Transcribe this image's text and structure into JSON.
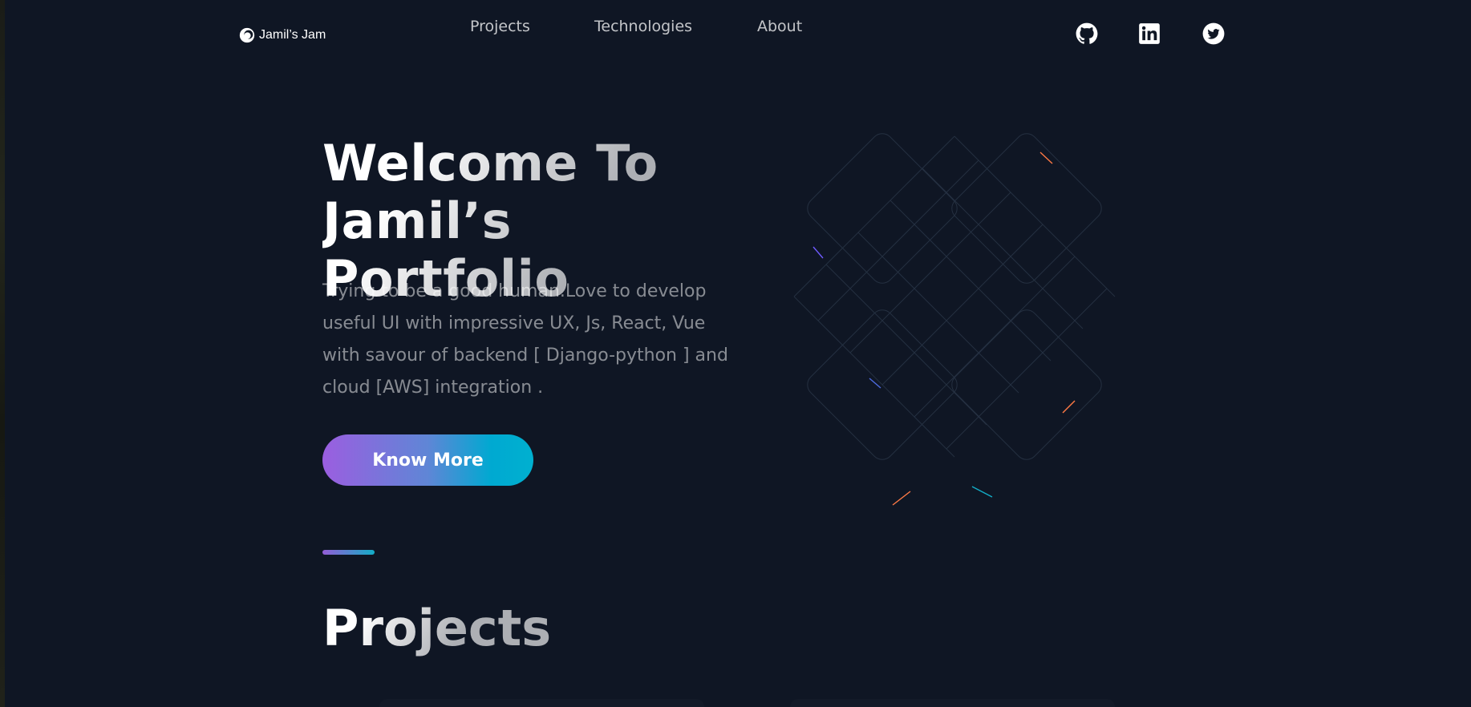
{
  "header": {
    "brand": {
      "name": "Jamil’s Jam",
      "icon": "logo-icon"
    },
    "nav": [
      {
        "label": "Projects"
      },
      {
        "label": "Technologies"
      },
      {
        "label": "About"
      }
    ],
    "socials": [
      {
        "icon": "github-icon"
      },
      {
        "icon": "linkedin-icon"
      },
      {
        "icon": "twitter-icon"
      }
    ]
  },
  "hero": {
    "title_line1": "Welcome To",
    "title_line2": "Jamil’s Portfolio",
    "description": "Trying to be a good human.Love to develop useful UI with impressive UX, Js, React, Vue with savour of backend [ Django-python ] and cloud [AWS] integration .",
    "cta_label": "Know More"
  },
  "projects": {
    "title": "Projects"
  },
  "colors": {
    "background": "#0f1624",
    "gradient_start": "#945dd6",
    "gradient_end": "#13adc7"
  }
}
